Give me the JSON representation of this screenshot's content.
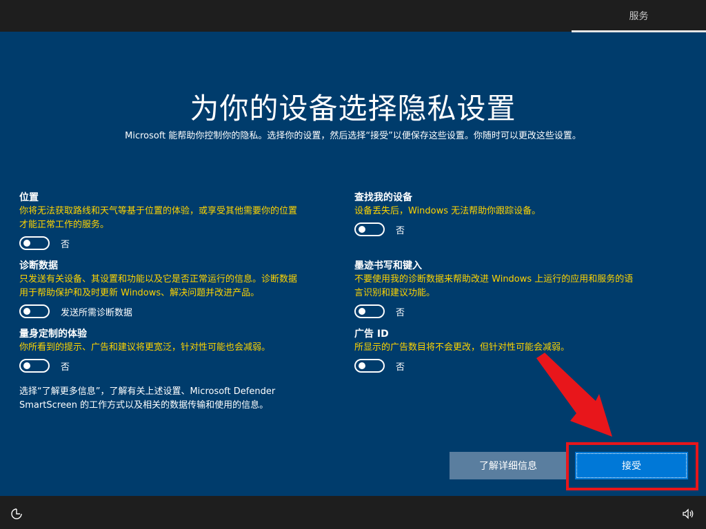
{
  "header": {
    "tab_label": "服务"
  },
  "title": "为你的设备选择隐私设置",
  "subtitle": "Microsoft 能帮助你控制你的隐私。选择你的设置，然后选择“接受”以便保存这些设置。你随时可以更改这些设置。",
  "settings": {
    "location": {
      "heading": "位置",
      "desc_line1": "你将无法获取路线和天气等基于位置的体验，或享受其他需要你的位置",
      "desc_line2": "才能正常工作的服务。",
      "toggle_label": "否"
    },
    "find_device": {
      "heading": "查找我的设备",
      "desc_line1": "设备丢失后，Windows 无法帮助你跟踪设备。",
      "toggle_label": "否"
    },
    "diagnostics": {
      "heading": "诊断数据",
      "desc_line1": "只发送有关设备、其设置和功能以及它是否正常运行的信息。诊断数据",
      "desc_line2": "用于帮助保护和及时更新 Windows、解决问题并改进产品。",
      "toggle_label": "发送所需诊断数据"
    },
    "inking": {
      "heading": "墨迹书写和键入",
      "desc_line1": "不要使用我的诊断数据来帮助改进 Windows 上运行的应用和服务的语",
      "desc_line2": "言识别和建议功能。",
      "toggle_label": "否"
    },
    "tailored": {
      "heading": "量身定制的体验",
      "desc_line1": "你所看到的提示、广告和建议将更宽泛，针对性可能也会减弱。",
      "toggle_label": "否"
    },
    "ad_id": {
      "heading": "广告 ID",
      "desc_line1": "所显示的广告数目将不会更改，但针对性可能会减弱。",
      "toggle_label": "否"
    }
  },
  "footnote": {
    "line1": "选择“了解更多信息”，了解有关上述设置、Microsoft Defender",
    "line2": "SmartScreen 的工作方式以及相关的数据传输和使用的信息。"
  },
  "buttons": {
    "learn_more": "了解详细信息",
    "accept": "接受"
  },
  "icons": {
    "ease_of_access": "ease-of-access-icon",
    "volume": "volume-icon"
  },
  "colors": {
    "background": "#003c6c",
    "description_text": "#ffd400",
    "accept_button": "#0078d7",
    "learn_more_button": "#5a7e9f",
    "annotation_red": "#e8161b"
  }
}
